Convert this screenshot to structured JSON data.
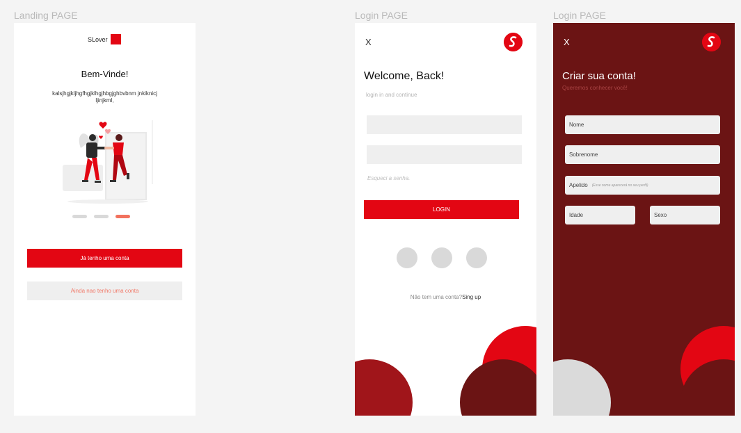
{
  "frames": {
    "landing": {
      "label": "Landing PAGE",
      "brand_text": "SLover",
      "title": "Bem-Vinde!",
      "description": "kalsjhgjkljhgfhgjklhgjhbgjghbvbnm jnkiknicjljinjkml,",
      "pagination": {
        "total": 3,
        "active": 3
      },
      "primary_button": "Já tenho uma conta",
      "secondary_button": "Ainda nao tenho uma conta"
    },
    "login": {
      "label": "Login PAGE",
      "close": "X",
      "title": "Welcome, Back!",
      "subtitle": "login in and continue",
      "forgot": "Esqueci a senha.",
      "login_button": "LOGIN",
      "no_account": "Não tem uma conta?",
      "signup_link": "Sing up"
    },
    "signup": {
      "label": "Login PAGE",
      "close": "X",
      "title": "Criar sua conta!",
      "subtitle": "Queremos conhecer você!",
      "fields": {
        "nome": "Nome",
        "sobrenome": "Sobrenome",
        "apelido": "Apelido",
        "apelido_hint": "(Esse nome aparecerá no seu perfil)",
        "idade": "Idade",
        "sexo": "Sexo"
      }
    }
  },
  "colors": {
    "accent": "#e30613",
    "dark_red": "#6b1414",
    "pagination_active": "#f2725e"
  }
}
